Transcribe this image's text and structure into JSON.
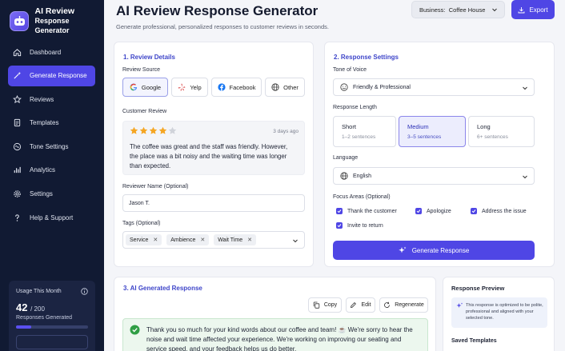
{
  "brand": {
    "line1": "AI Review",
    "line2": "Response Generator"
  },
  "nav": [
    {
      "label": "Dashboard",
      "icon": "home-icon",
      "active": false
    },
    {
      "label": "Generate Response",
      "icon": "magic-wand-icon",
      "active": true
    },
    {
      "label": "Reviews",
      "icon": "star-icon",
      "active": false
    },
    {
      "label": "Templates",
      "icon": "document-icon",
      "active": false
    },
    {
      "label": "Tone Settings",
      "icon": "tone-icon",
      "active": false
    },
    {
      "label": "Analytics",
      "icon": "bar-chart-icon",
      "active": false
    },
    {
      "label": "Settings",
      "icon": "gear-icon",
      "active": false
    },
    {
      "label": "Help & Support",
      "icon": "help-icon",
      "active": false
    }
  ],
  "usage": {
    "title": "Usage This Month",
    "used": "42",
    "total": "/ 200",
    "label": "Responses Generated",
    "fraction": 0.21
  },
  "header": {
    "title": "AI Review Response Generator",
    "subtitle": "Generate professional, personalized responses to customer reviews in seconds.",
    "business_label": "Business:",
    "business_value": "Coffee House",
    "export_label": "Export"
  },
  "review_details": {
    "title": "1. Review Details",
    "source_label": "Review Source",
    "sources": [
      {
        "label": "Google",
        "icon": "google-icon",
        "active": true
      },
      {
        "label": "Yelp",
        "icon": "yelp-icon",
        "active": false
      },
      {
        "label": "Facebook",
        "icon": "facebook-icon",
        "active": false
      },
      {
        "label": "Other",
        "icon": "globe-icon",
        "active": false
      }
    ],
    "review_label": "Customer Review",
    "rating": 4,
    "review_age": "3 days ago",
    "review_text": "The coffee was great and the staff was friendly. However, the place was a bit noisy and the waiting time was longer than expected.",
    "reviewer_label": "Reviewer Name (Optional)",
    "reviewer_value": "Jason T.",
    "tags_label": "Tags (Optional)",
    "tags": [
      "Service",
      "Ambience",
      "Wait Time"
    ]
  },
  "response_settings": {
    "title": "2. Response Settings",
    "tone_label": "Tone of Voice",
    "tone_value": "Friendly & Professional",
    "length_label": "Response Length",
    "lengths": [
      {
        "title": "Short",
        "sub": "1–2 sentences",
        "active": false
      },
      {
        "title": "Medium",
        "sub": "3–5 sentences",
        "active": true
      },
      {
        "title": "Long",
        "sub": "6+ sentences",
        "active": false
      }
    ],
    "language_label": "Language",
    "language_value": "English",
    "focus_label": "Focus Areas (Optional)",
    "focus": [
      "Thank the customer",
      "Apologize",
      "Address the issue",
      "Invite to return"
    ],
    "generate_label": "Generate Response"
  },
  "generated": {
    "title": "3. AI Generated Response",
    "copy_label": "Copy",
    "edit_label": "Edit",
    "regenerate_label": "Regenerate",
    "text": "Thank you so much for your kind words about our coffee and team! ☕ We're sorry to hear the noise and wait time affected your experience. We're working on improving our seating and service speed, and your feedback helps us do better."
  },
  "preview": {
    "title": "Response Preview",
    "note": "This response is optimized to be polite, professional and aligned with your selected tone.",
    "saved_title": "Saved Templates"
  },
  "colors": {
    "accent": "#4f46e5",
    "sidebar": "#111a33",
    "star": "#f5a623",
    "success": "#2f9e44"
  }
}
